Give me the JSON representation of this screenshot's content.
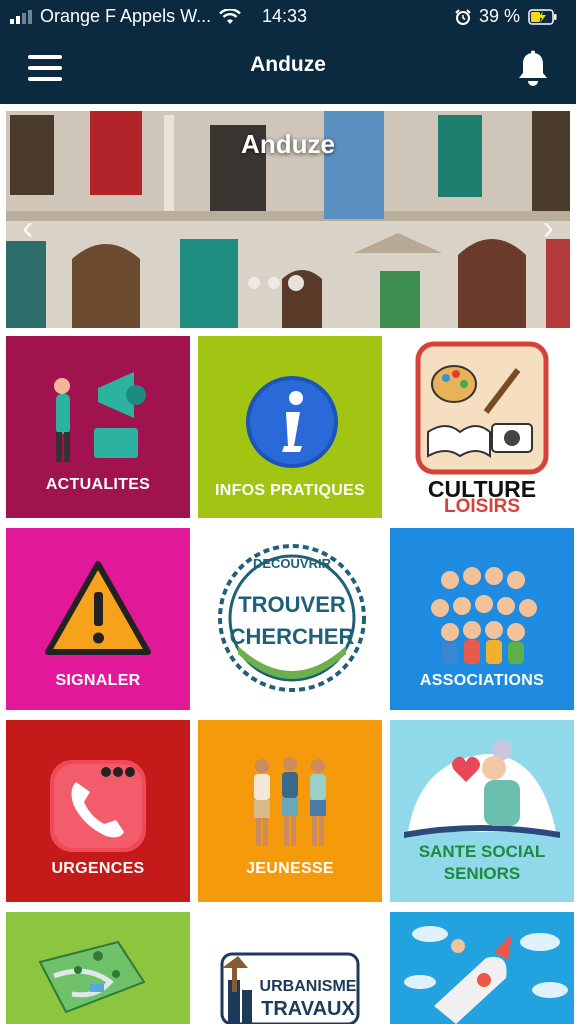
{
  "status_bar": {
    "carrier": "Orange F Appels W...",
    "time": "14:33",
    "battery": "39 %"
  },
  "header": {
    "title": "Anduze"
  },
  "hero": {
    "title": "Anduze",
    "slide_count": 3,
    "active_slide": 2
  },
  "tiles": [
    {
      "label": "ACTUALITES",
      "bg": "#a0134e"
    },
    {
      "label": "INFOS PRATIQUES",
      "bg": "#a2c514"
    },
    {
      "line1": "CULTURE",
      "line2": "LOISIRS",
      "bg": "#ffffff"
    },
    {
      "label": "SIGNALER",
      "bg": "#e2189a"
    },
    {
      "badge_top": "DECOUVRIR",
      "badge_mid": "TROUVER",
      "badge_bot": "CHERCHER",
      "bg": "#ffffff"
    },
    {
      "label": "ASSOCIATIONS",
      "bg": "#1f8be0"
    },
    {
      "label": "URGENCES",
      "bg": "#c51a1a"
    },
    {
      "label": "JEUNESSE",
      "bg": "#f59a0b"
    },
    {
      "line1": "SANTE SOCIAL",
      "line2": "SENIORS",
      "bg": "#8fd9ea"
    },
    {
      "bg": "#8cc63f"
    },
    {
      "line1": "URBANISME",
      "line2": "TRAVAUX",
      "bg": "#ffffff"
    },
    {
      "bg": "#22a3df"
    }
  ],
  "colors": {
    "header_bg": "#0b2a40",
    "page_bg": "#ffffff"
  }
}
